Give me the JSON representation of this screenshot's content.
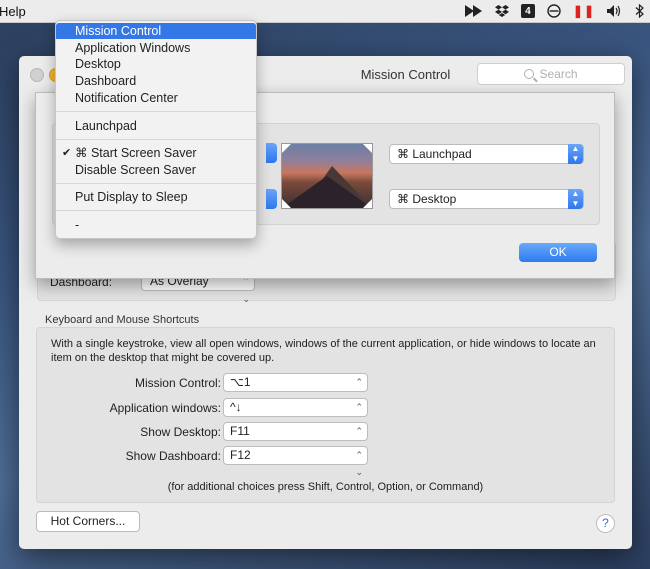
{
  "menubar": {
    "help_label": "Help",
    "tray": {
      "badge_number": "4",
      "pause_glyph": "❚❚",
      "icons": [
        "forward-icon",
        "dropbox-icon",
        "badge-4-icon",
        "cancel-circle-icon",
        "pause-icon",
        "volume-icon",
        "bluetooth-icon"
      ]
    }
  },
  "window": {
    "title": "Mission Control",
    "search_placeholder": "Search",
    "dashboard_label": "Dashboard:",
    "dashboard_value": "As Overlay",
    "keyboard_section_title": "Keyboard and Mouse Shortcuts",
    "keyboard_description": "With a single keystroke, view all open windows, windows of the current application, or hide windows to locate an item on the desktop that might be covered up.",
    "shortcuts": [
      {
        "label": "Mission Control:",
        "value": "⌥1"
      },
      {
        "label": "Application windows:",
        "value": "^↓"
      },
      {
        "label": "Show Desktop:",
        "value": "F11"
      },
      {
        "label": "Show Dashboard:",
        "value": "F12"
      }
    ],
    "footnote": "(for additional choices press Shift, Control, Option, or Command)",
    "hot_corners_button": "Hot Corners...",
    "help_button": "?"
  },
  "hot_corners_sheet": {
    "top_right_value": "⌘ Launchpad",
    "bottom_right_value": "⌘ Desktop",
    "ok_label": "OK"
  },
  "corner_menu": {
    "items": [
      {
        "label": "Mission Control",
        "selected": true
      },
      {
        "label": "Application Windows"
      },
      {
        "label": "Desktop"
      },
      {
        "label": "Dashboard"
      },
      {
        "label": "Notification Center"
      },
      {
        "label": "Launchpad"
      },
      {
        "label": "⌘ Start Screen Saver",
        "checked": true
      },
      {
        "label": "Disable Screen Saver"
      },
      {
        "label": "Put Display to Sleep"
      },
      {
        "label": "-"
      }
    ]
  },
  "colors": {
    "accent": "#3478e8",
    "ok_button": "#2b7bf0"
  }
}
